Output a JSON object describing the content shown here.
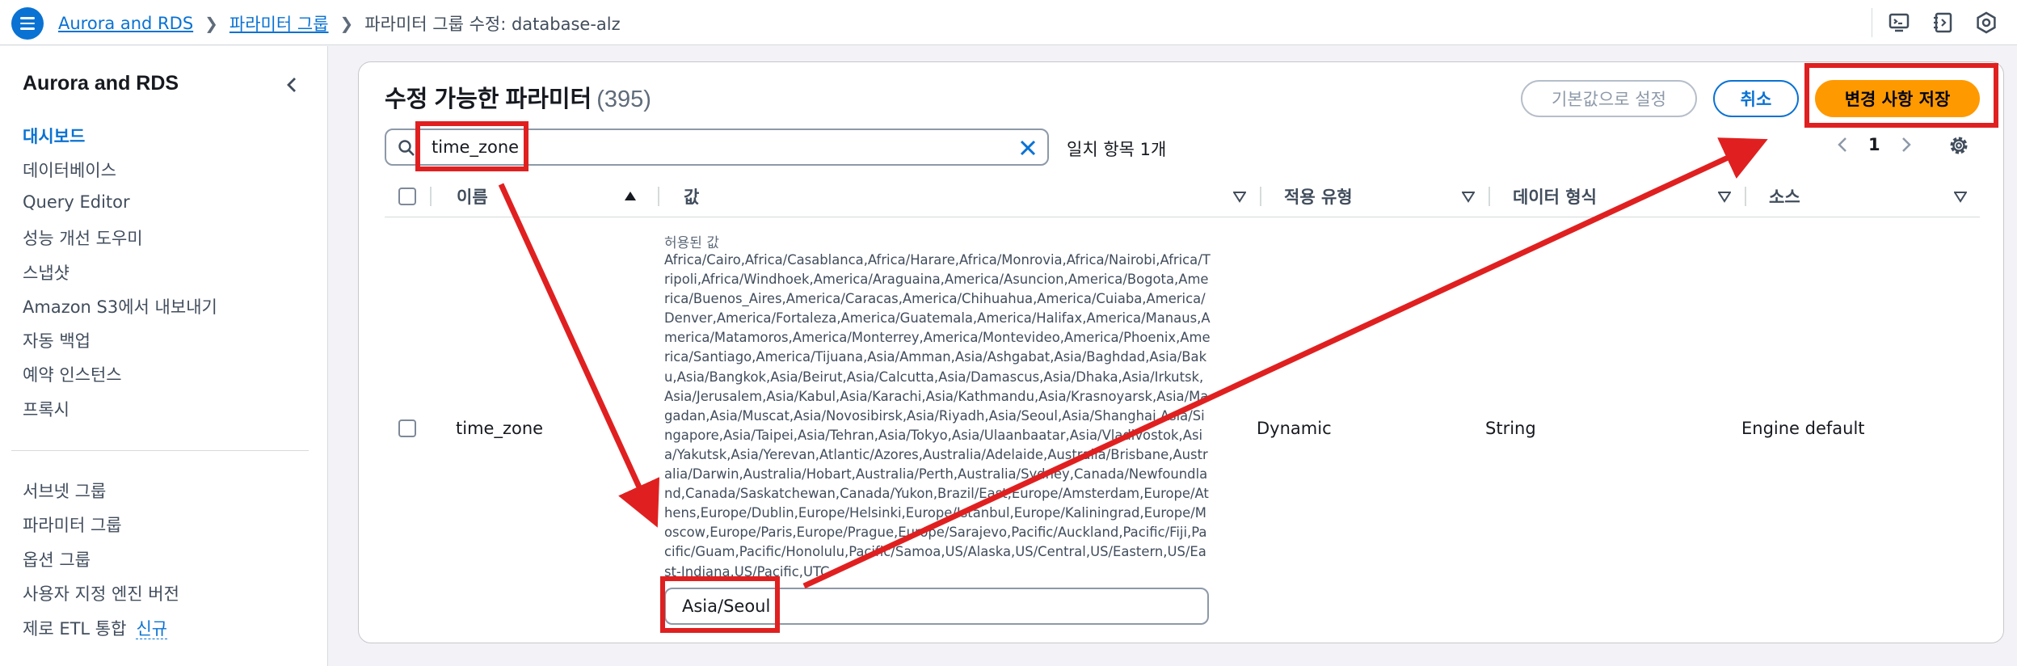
{
  "header": {
    "breadcrumbs": [
      "Aurora and RDS",
      "파라미터 그룹"
    ],
    "current": "파라미터 그룹 수정: database-alz",
    "icons": [
      "menu-icon",
      "chevron-right-icon",
      "cloudshell-icon",
      "notifications-icon",
      "settings-icon"
    ]
  },
  "sidebar": {
    "title": "Aurora and RDS",
    "items": [
      {
        "label": "대시보드",
        "active": true
      },
      {
        "label": "데이터베이스"
      },
      {
        "label": "Query Editor"
      },
      {
        "label": "성능 개선 도우미"
      },
      {
        "label": "스냅샷"
      },
      {
        "label": "Amazon S3에서 내보내기"
      },
      {
        "label": "자동 백업"
      },
      {
        "label": "예약 인스턴스"
      },
      {
        "label": "프록시"
      }
    ],
    "items2": [
      {
        "label": "서브넷 그룹"
      },
      {
        "label": "파라미터 그룹"
      },
      {
        "label": "옵션 그룹"
      },
      {
        "label": "사용자 지정 엔진 버전"
      },
      {
        "label": "제로 ETL 통합",
        "badge": "신규"
      }
    ]
  },
  "panel": {
    "title": "수정 가능한 파라미터",
    "count": "(395)",
    "reset_label": "기본값으로 설정",
    "cancel_label": "취소",
    "save_label": "변경 사항 저장",
    "search_value": "time_zone",
    "match_text": "일치 항목 1개",
    "page": "1"
  },
  "table": {
    "columns": [
      "이름",
      "값",
      "적용 유형",
      "데이터 형식",
      "소스"
    ],
    "row": {
      "name": "time_zone",
      "allowed_label": "허용된 값",
      "allowed_values": "Africa/Cairo,Africa/Casablanca,Africa/Harare,Africa/Monrovia,Africa/Nairobi,Africa/Tripoli,Africa/Windhoek,America/Araguaina,America/Asuncion,America/Bogota,America/Buenos_Aires,America/Caracas,America/Chihuahua,America/Cuiaba,America/Denver,America/Fortaleza,America/Guatemala,America/Halifax,America/Manaus,America/Matamoros,America/Monterrey,America/Montevideo,America/Phoenix,America/Santiago,America/Tijuana,Asia/Amman,Asia/Ashgabat,Asia/Baghdad,Asia/Baku,Asia/Bangkok,Asia/Beirut,Asia/Calcutta,Asia/Damascus,Asia/Dhaka,Asia/Irkutsk,Asia/Jerusalem,Asia/Kabul,Asia/Karachi,Asia/Kathmandu,Asia/Krasnoyarsk,Asia/Magadan,Asia/Muscat,Asia/Novosibirsk,Asia/Riyadh,Asia/Seoul,Asia/Shanghai,Asia/Singapore,Asia/Taipei,Asia/Tehran,Asia/Tokyo,Asia/Ulaanbaatar,Asia/Vladivostok,Asia/Yakutsk,Asia/Yerevan,Atlantic/Azores,Australia/Adelaide,Australia/Brisbane,Australia/Darwin,Australia/Hobart,Australia/Perth,Australia/Sydney,Canada/Newfoundland,Canada/Saskatchewan,Canada/Yukon,Brazil/East,Europe/Amsterdam,Europe/Athens,Europe/Dublin,Europe/Helsinki,Europe/Istanbul,Europe/Kaliningrad,Europe/Moscow,Europe/Paris,Europe/Prague,Europe/Sarajevo,Pacific/Auckland,Pacific/Fiji,Pacific/Guam,Pacific/Honolulu,Pacific/Samoa,US/Alaska,US/Central,US/Eastern,US/East-Indiana,US/Pacific,UTC",
      "value": "Asia/Seoul",
      "apply_type": "Dynamic",
      "data_type": "String",
      "source": "Engine default"
    }
  },
  "colors": {
    "accent": "#0972d3",
    "primary_button": "#ff9900",
    "annotation": "#e02020"
  }
}
